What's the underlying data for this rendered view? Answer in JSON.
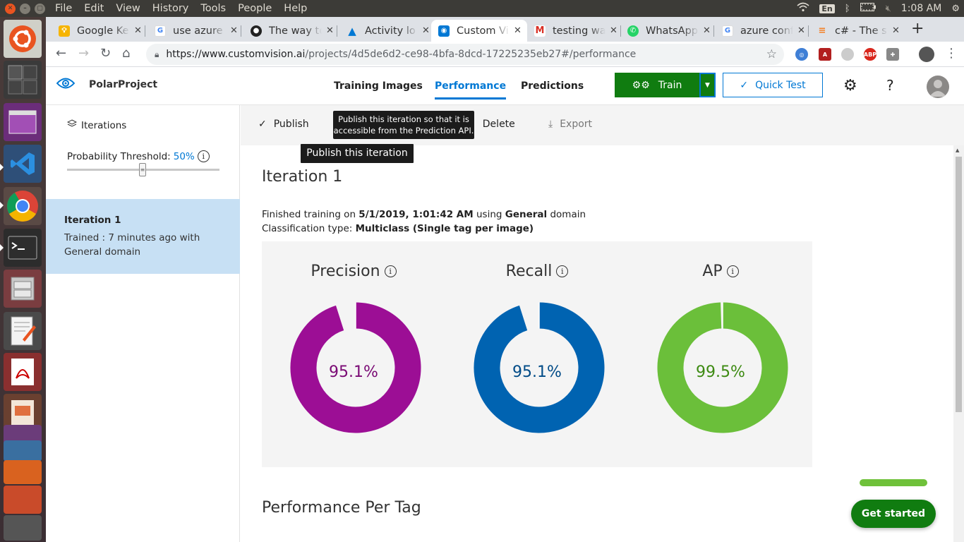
{
  "os": {
    "menu": [
      "File",
      "Edit",
      "View",
      "History",
      "Tools",
      "People",
      "Help"
    ],
    "keyboard_lang": "En",
    "time": "1:08 AM"
  },
  "browser": {
    "tabs": [
      {
        "title": "Google Ke",
        "icon": "google-keep-icon",
        "color": "#f6b400"
      },
      {
        "title": "use azure",
        "icon": "google-icon",
        "color": "#4285f4"
      },
      {
        "title": "The way to",
        "icon": "github-icon",
        "color": "#222222"
      },
      {
        "title": "Activity lo",
        "icon": "azure-icon",
        "color": "#0078d4"
      },
      {
        "title": "Custom Vi",
        "icon": "custom-vision-icon",
        "color": "#0078d4"
      },
      {
        "title": "testing wa",
        "icon": "gmail-icon",
        "color": "#d93025"
      },
      {
        "title": "WhatsApp",
        "icon": "whatsapp-icon",
        "color": "#25d366"
      },
      {
        "title": "azure conf",
        "icon": "google-icon",
        "color": "#4285f4"
      },
      {
        "title": "c# - The sp",
        "icon": "stackoverflow-icon",
        "color": "#f48024"
      }
    ],
    "url_host": "https://www.customvision.ai",
    "url_path": "/projects/4d5de6d2-ce98-4bfa-8dcd-17225235eb27#/performance"
  },
  "app": {
    "project_name": "PolarProject",
    "nav": [
      "Training Images",
      "Performance",
      "Predictions"
    ],
    "train_label": "Train",
    "quick_test_label": "Quick Test",
    "help_label": "?"
  },
  "sidebar": {
    "iterations_label": "Iterations",
    "threshold_label": "Probability Threshold:",
    "threshold_value": "50%",
    "iteration": {
      "name": "Iteration 1",
      "description": "Trained : 7 minutes ago with General domain"
    }
  },
  "commands": {
    "publish": "Publish",
    "delete": "Delete",
    "export": "Export",
    "tooltip_long": "Publish this iteration so that it is accessible from the Prediction API.",
    "tooltip_short": "Publish this iteration"
  },
  "iteration_detail": {
    "title": "Iteration 1",
    "finished_prefix": "Finished training on ",
    "finished_date": "5/1/2019, 1:01:42 AM",
    "finished_mid": " using ",
    "domain": "General",
    "finished_suffix": " domain",
    "classification_prefix": "Classification type: ",
    "classification_type": "Multiclass (Single tag per image)"
  },
  "metrics": [
    {
      "label": "Precision",
      "value": 95.1,
      "text": "95.1%",
      "color": "#9c0e95",
      "text_color": "#7a0a74"
    },
    {
      "label": "Recall",
      "value": 95.1,
      "text": "95.1%",
      "color": "#0063b1",
      "text_color": "#004b87"
    },
    {
      "label": "AP",
      "value": 99.5,
      "text": "99.5%",
      "color": "#6bbf3a",
      "text_color": "#3d8a12"
    }
  ],
  "per_tag_title": "Performance Per Tag",
  "get_started_label": "Get started"
}
